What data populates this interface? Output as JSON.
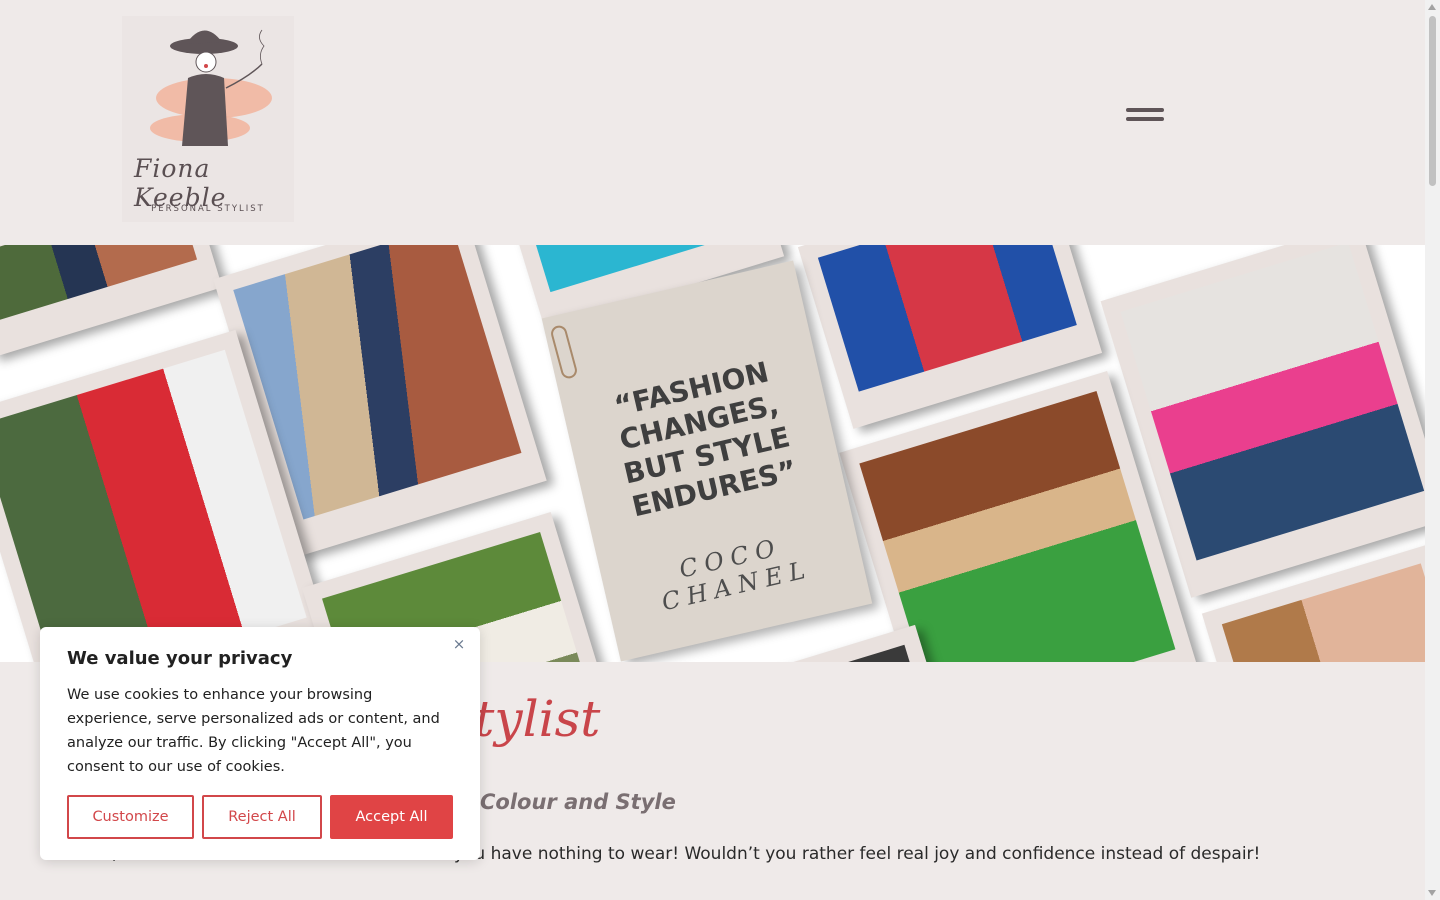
{
  "header": {
    "logo_script": "Fiona Keeble",
    "logo_sub": "PERSONAL STYLIST"
  },
  "hero": {
    "quote": "“FASHION CHANGES, BUT STYLE ENDURES”",
    "author": "COCO CHANEL"
  },
  "content": {
    "script_title": "Stylist",
    "subheading": "Colour and Style",
    "body": ", see a mountain of clothes but feel like you have nothing to wear! Wouldn’t you rather feel real joy and confidence instead of despair!"
  },
  "cookie": {
    "title": "We value your privacy",
    "text": "We use cookies to enhance your browsing experience, serve personalized ads or content, and analyze our traffic. By clicking \"Accept All\", you consent to our use of cookies.",
    "close": "×",
    "customize": "Customize",
    "reject": "Reject All",
    "accept": "Accept All"
  },
  "icons": {
    "menu": "hamburger-menu-icon",
    "close": "close-icon"
  },
  "colors": {
    "accent": "#e04445",
    "background": "#efeae9",
    "script": "#c9454a"
  }
}
